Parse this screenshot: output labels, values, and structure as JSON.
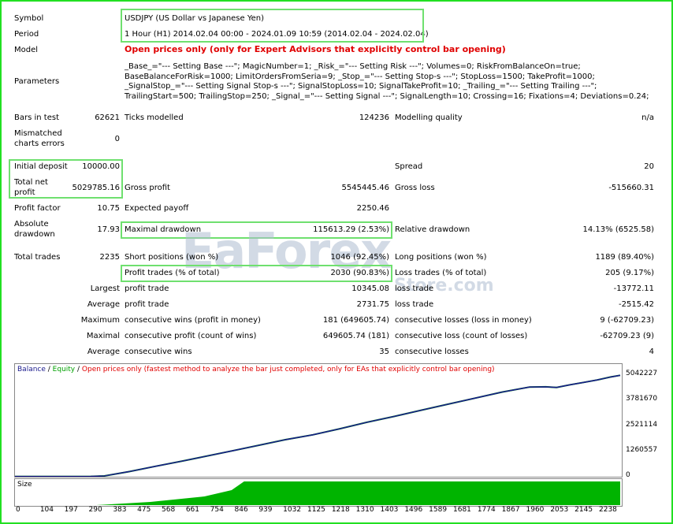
{
  "labels": {
    "symbol": "Symbol",
    "period": "Period",
    "model": "Model",
    "parameters": "Parameters",
    "bars_in_test": "Bars in test",
    "ticks_modelled": "Ticks modelled",
    "modelling_quality": "Modelling quality",
    "mismatched_line1": "Mismatched",
    "mismatched_line2": "charts errors",
    "initial_deposit": "Initial deposit",
    "spread": "Spread",
    "total_net_profit_line1": "Total net",
    "total_net_profit_line2": "profit",
    "gross_profit": "Gross profit",
    "gross_loss": "Gross loss",
    "profit_factor": "Profit factor",
    "expected_payoff": "Expected payoff",
    "absolute_dd_line1": "Absolute",
    "absolute_dd_line2": "drawdown",
    "maximal_drawdown": "Maximal drawdown",
    "relative_drawdown": "Relative drawdown",
    "total_trades": "Total trades",
    "short_positions": "Short positions (won %)",
    "long_positions": "Long positions (won %)",
    "profit_trades": "Profit trades (% of total)",
    "loss_trades": "Loss trades (% of total)",
    "largest": "Largest",
    "average": "Average",
    "maximum": "Maximum",
    "maximal": "Maximal",
    "profit_trade": "profit trade",
    "loss_trade": "loss trade",
    "consec_wins_money": "consecutive wins (profit in money)",
    "consec_losses_money": "consecutive losses (loss in money)",
    "consec_profit_count": "consecutive profit (count of wins)",
    "consec_loss_count": "consecutive loss (count of losses)",
    "consec_wins": "consecutive wins",
    "consec_losses": "consecutive losses"
  },
  "values": {
    "symbol": "USDJPY (US Dollar vs Japanese Yen)",
    "period": "1 Hour (H1) 2014.02.04 00:00 - 2024.01.09 10:59 (2014.02.04 - 2024.02.04)",
    "model": "Open prices only (only for Expert Advisors that explicitly control bar opening)",
    "parameters": "_Base_=\"--- Setting Base ---\"; MagicNumber=1; _Risk_=\"--- Setting Risk ---\"; Volumes=0; RiskFromBalanceOn=true; BaseBalanceForRisk=1000; LimitOrdersFromSeria=9; _Stop_=\"--- Setting Stop-s ---\"; StopLoss=1500; TakeProfit=1000; _SignalStop_=\"--- Setting Signal Stop-s ---\"; SignalStopLoss=10; SignalTakeProfit=10; _Trailing_=\"--- Setting Trailing ---\"; TrailingStart=500; TrailingStop=250; _Signal_=\"--- Setting Signal ---\"; SignalLength=10; Crossing=16; Fixations=4; Deviations=0.24;",
    "bars_in_test": "62621",
    "ticks_modelled": "124236",
    "modelling_quality": "n/a",
    "mismatched": "0",
    "initial_deposit": "10000.00",
    "spread": "20",
    "total_net_profit": "5029785.16",
    "gross_profit": "5545445.46",
    "gross_loss": "-515660.31",
    "profit_factor": "10.75",
    "expected_payoff": "2250.46",
    "absolute_drawdown": "17.93",
    "maximal_drawdown": "115613.29 (2.53%)",
    "relative_drawdown": "14.13% (6525.58)",
    "total_trades": "2235",
    "short_positions": "1046 (92.45%)",
    "long_positions": "1189 (89.40%)",
    "profit_trades": "2030 (90.83%)",
    "loss_trades": "205 (9.17%)",
    "largest_profit": "10345.08",
    "largest_loss": "-13772.11",
    "average_profit": "2731.75",
    "average_loss": "-2515.42",
    "max_consec_wins": "181 (649605.74)",
    "max_consec_losses": "9 (-62709.23)",
    "maximal_consec_profit": "649605.74 (181)",
    "maximal_consec_loss": "-62709.23 (9)",
    "avg_consec_wins": "35",
    "avg_consec_losses": "4"
  },
  "watermark": {
    "line1": "EaForex",
    "line2": "Store.com"
  },
  "chart_data": {
    "type": "line",
    "legend": {
      "balance": "Balance",
      "sep1": " / ",
      "equity": "Equity",
      "sep2": " / ",
      "note": "Open prices only (fastest method to analyze the bar just completed, only for EAs that explicitly control bar opening)"
    },
    "colors": {
      "balance": "#1a1a8c",
      "equity": "#00a000",
      "size": "#00b400",
      "note": "#e00000"
    },
    "yticks": [
      "5042227",
      "3781670",
      "2521114",
      "1260557",
      "0"
    ],
    "ylim": [
      0,
      5042227
    ],
    "xticks": [
      "0",
      "104",
      "197",
      "290",
      "383",
      "475",
      "568",
      "661",
      "754",
      "846",
      "939",
      "1032",
      "1125",
      "1218",
      "1310",
      "1403",
      "1496",
      "1589",
      "1681",
      "1774",
      "1867",
      "1960",
      "2053",
      "2145",
      "2238"
    ],
    "size_label": "Size",
    "x": [
      0,
      150,
      280,
      330,
      420,
      520,
      620,
      700,
      800,
      900,
      1000,
      1100,
      1200,
      1300,
      1400,
      1500,
      1600,
      1700,
      1800,
      1900,
      1960,
      2000,
      2050,
      2100,
      2150,
      2200,
      2235
    ],
    "y": [
      10000,
      12000,
      15000,
      40000,
      250000,
      520000,
      780000,
      1000000,
      1280000,
      1560000,
      1840000,
      2080000,
      2380000,
      2700000,
      2990000,
      3300000,
      3600000,
      3900000,
      4200000,
      4450000,
      4460000,
      4430000,
      4560000,
      4680000,
      4800000,
      4950000,
      5029785
    ]
  }
}
